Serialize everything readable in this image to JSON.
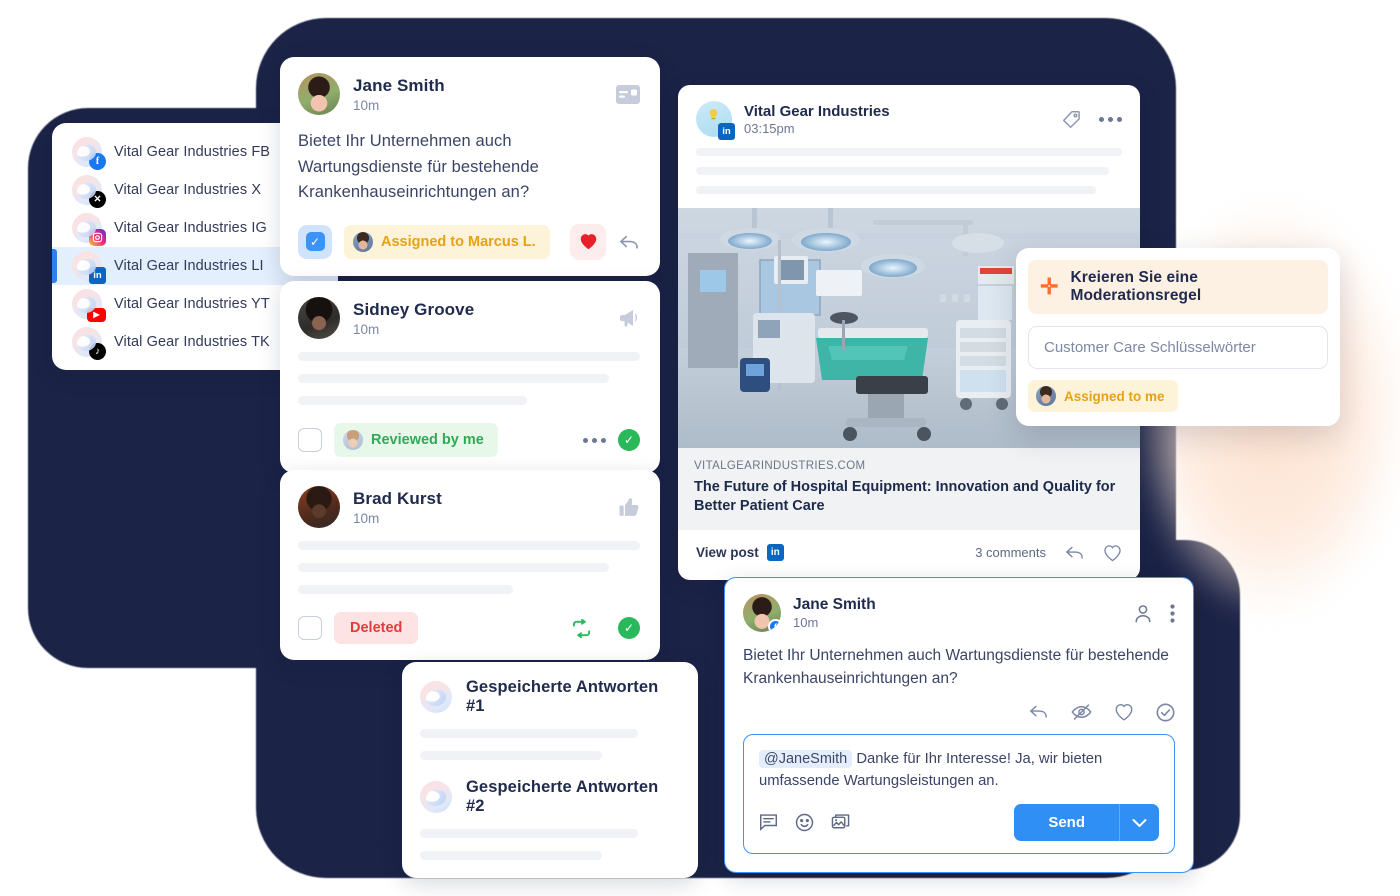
{
  "sidebar": {
    "channels": [
      {
        "label": "Vital Gear Industries FB",
        "network": "facebook",
        "active": false
      },
      {
        "label": "Vital Gear Industries X",
        "network": "x",
        "active": false
      },
      {
        "label": "Vital Gear Industries IG",
        "network": "instagram",
        "active": false
      },
      {
        "label": "Vital Gear Industries LI",
        "network": "linkedin",
        "active": true
      },
      {
        "label": "Vital Gear Industries YT",
        "network": "youtube",
        "active": false
      },
      {
        "label": "Vital Gear Industries TK",
        "network": "tiktok",
        "active": false
      }
    ]
  },
  "messages": [
    {
      "name": "Jane Smith",
      "time": "10m",
      "head_icon": "message-card-icon",
      "body": "Bietet Ihr Unternehmen auch Wartungsdienste für bestehende Krankenhauseinrichtungen an?",
      "status_label": "Assigned to Marcus L.",
      "status_type": "assigned",
      "checked": true,
      "actions": [
        "heart-icon",
        "reply-icon"
      ]
    },
    {
      "name": "Sidney Groove",
      "time": "10m",
      "head_icon": "megaphone-icon",
      "body": "",
      "status_label": "Reviewed by me",
      "status_type": "reviewed",
      "checked": false,
      "actions": [
        "more-icon",
        "check-circle-icon"
      ]
    },
    {
      "name": "Brad Kurst",
      "time": "10m",
      "head_icon": "thumbs-up-icon",
      "body": "",
      "status_label": "Deleted",
      "status_type": "deleted",
      "checked": false,
      "actions": [
        "repost-icon",
        "check-circle-icon"
      ]
    }
  ],
  "post": {
    "author": "Vital Gear Industries",
    "time": "03:15pm",
    "tag_icon": "tag-icon",
    "more_icon": "more-icon",
    "link_domain": "VITALGEARINDUSTRIES.COM",
    "link_title": "The Future of Hospital Equipment: Innovation and Quality for Better Patient Care",
    "view_post_label": "View post",
    "comments_label": "3 comments",
    "network_badge": "in"
  },
  "moderation_rule": {
    "title": "Kreieren Sie eine Moderationsregel",
    "plus_icon": "plus-icon",
    "input_placeholder": "Customer Care Schlüsselwörter",
    "input_value": "",
    "assigned_label": "Assigned to me",
    "accent": "#f4712a"
  },
  "composer": {
    "name": "Jane Smith",
    "time": "10m",
    "network_badge": "f",
    "body": "Bietet Ihr Unternehmen auch Wartungsdienste für bestehende Krankenhauseinrichtungen an?",
    "head_icons": [
      "person-icon",
      "kebab-menu-icon"
    ],
    "action_icons": [
      "reply-icon",
      "hide-icon",
      "heart-icon",
      "check-circle-icon"
    ],
    "reply_mention": "@JaneSmith",
    "reply_text": "Danke für Ihr Interesse! Ja, wir bieten umfassende Wartungsleistungen an.",
    "tool_icons": [
      "saved-reply-icon",
      "emoji-icon",
      "image-icon"
    ],
    "send_label": "Send",
    "send_caret_icon": "chevron-down-icon",
    "accent": "#2f8ff5"
  },
  "saved_replies": [
    {
      "title": "Gespeicherte Antworten #1"
    },
    {
      "title": "Gespeicherte Antworten #2"
    }
  ],
  "colors": {
    "backdrop": "#1b2347",
    "glow": "#fdf0e5",
    "blue": "#2f80ed",
    "green": "#2ab95a",
    "red": "#e23b3b",
    "amber": "#e8a117"
  }
}
